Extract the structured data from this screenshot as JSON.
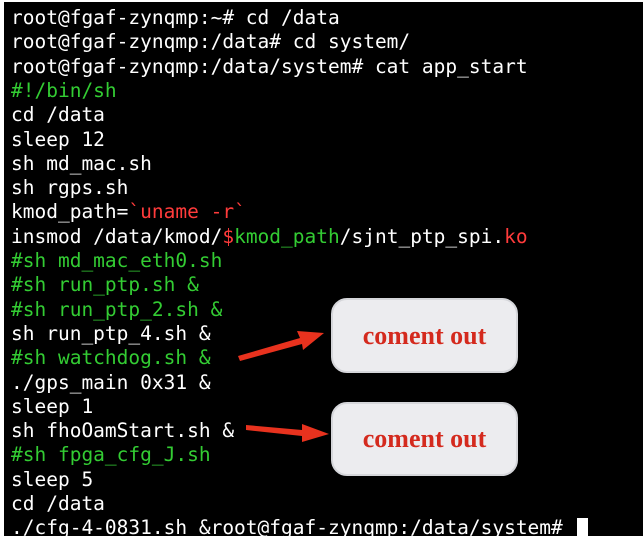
{
  "terminal": {
    "lines": [
      {
        "segments": [
          {
            "text": "root@fgaf-zynqmp:~# cd /data",
            "color": "#ffffff"
          }
        ]
      },
      {
        "segments": [
          {
            "text": "root@fgaf-zynqmp:/data# cd system/",
            "color": "#ffffff"
          }
        ]
      },
      {
        "segments": [
          {
            "text": "root@fgaf-zynqmp:/data/system# cat app_start",
            "color": "#ffffff"
          }
        ]
      },
      {
        "segments": [
          {
            "text": "#!/bin/sh",
            "color": "#33cc33"
          }
        ]
      },
      {
        "segments": [
          {
            "text": "cd /data",
            "color": "#ffffff"
          }
        ]
      },
      {
        "segments": [
          {
            "text": "sleep 12",
            "color": "#ffffff"
          }
        ]
      },
      {
        "segments": [
          {
            "text": "sh md_mac.sh",
            "color": "#ffffff"
          }
        ]
      },
      {
        "segments": [
          {
            "text": "sh rgps.sh",
            "color": "#ffffff"
          }
        ]
      },
      {
        "segments": [
          {
            "text": "kmod_path=",
            "color": "#ffffff"
          },
          {
            "text": "`uname -r`",
            "color": "#ff3b3b"
          }
        ]
      },
      {
        "segments": [
          {
            "text": "insmod /data/kmod/",
            "color": "#ffffff"
          },
          {
            "text": "$",
            "color": "#ff3b3b"
          },
          {
            "text": "kmod_path",
            "color": "#33cc33"
          },
          {
            "text": "/sjnt_ptp_spi.",
            "color": "#ffffff"
          },
          {
            "text": "ko",
            "color": "#ff3b3b"
          }
        ]
      },
      {
        "segments": [
          {
            "text": "#sh md_mac_eth0.sh",
            "color": "#33cc33"
          }
        ]
      },
      {
        "segments": [
          {
            "text": "#sh run_ptp.sh &",
            "color": "#33cc33"
          }
        ]
      },
      {
        "segments": [
          {
            "text": "#sh run_ptp_2.sh &",
            "color": "#33cc33"
          }
        ]
      },
      {
        "segments": [
          {
            "text": "sh run_ptp_4.sh &",
            "color": "#ffffff"
          }
        ]
      },
      {
        "segments": [
          {
            "text": "#sh watchdog.sh &",
            "color": "#33cc33"
          }
        ]
      },
      {
        "segments": [
          {
            "text": "./gps_main 0x31 &",
            "color": "#ffffff"
          }
        ]
      },
      {
        "segments": [
          {
            "text": "sleep 1",
            "color": "#ffffff"
          }
        ]
      },
      {
        "segments": [
          {
            "text": "sh fhoOamStart.sh &",
            "color": "#ffffff"
          }
        ]
      },
      {
        "segments": [
          {
            "text": "#sh fpga_cfg_J.sh",
            "color": "#33cc33"
          }
        ]
      },
      {
        "segments": [
          {
            "text": "sleep 5",
            "color": "#ffffff"
          }
        ]
      },
      {
        "segments": [
          {
            "text": "cd /data",
            "color": "#ffffff"
          }
        ]
      },
      {
        "segments": [
          {
            "text": "./cfg-4-0831.sh &root@fgaf-zynqmp:/data/system# ",
            "color": "#ffffff"
          }
        ],
        "cursor": true
      }
    ]
  },
  "annotations": {
    "callout_1": {
      "text": "coment out"
    },
    "callout_2": {
      "text": "coment out"
    },
    "colors": {
      "callout_text": "#d42a1e",
      "arrow": "#e8321e",
      "callout_bg": "#ececef"
    }
  }
}
